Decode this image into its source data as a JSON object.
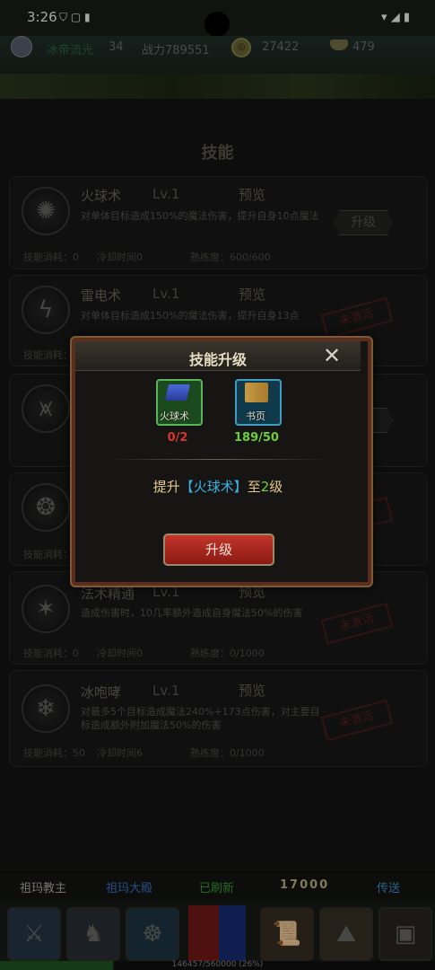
{
  "status_bar": {
    "time": "3:26"
  },
  "player": {
    "name": "冰帝流光",
    "level": "34",
    "power": "战力789551",
    "coins": "27422",
    "ingots": "479"
  },
  "panel": {
    "title": "技能"
  },
  "skills": [
    {
      "name": "火球术",
      "level": "Lv.1",
      "preview": "预览",
      "desc": "对单体目标造成150%的魔法伤害，提升自身10点魔法",
      "cost": "技能消耗：0",
      "cooldown": "冷却时间0",
      "mastery": "熟练度：600/600",
      "action": "升级"
    },
    {
      "name": "雷电术",
      "level": "Lv.1",
      "preview": "预览",
      "desc": "对单体目标造成150%的魔法伤害，提升自身13点",
      "cost": "技能消耗：",
      "stamp": "未激活"
    },
    {
      "name": "法术精通",
      "level": "Lv.1",
      "preview": "预览",
      "desc": "造成伤害时，10几率额外造成自身魔法50%的伤害",
      "cost": "技能消耗：0",
      "cooldown": "冷却时间0",
      "mastery": "熟练度：0/1000",
      "stamp": "未激活"
    },
    {
      "name": "冰咆哮",
      "level": "Lv.1",
      "preview": "预览",
      "desc": "对最多5个目标造成魔法240%+173点伤害，对主要目标造成额外附加魔法50%的伤害",
      "cost": "技能消耗：50",
      "cooldown": "冷却时间6",
      "mastery": "熟练度：0/1000",
      "stamp": "未激活"
    }
  ],
  "partial": {
    "cost": "技能消耗：",
    "learn": "习"
  },
  "modal": {
    "title": "技能升级",
    "item1_label": "火球术",
    "item1_count": "0/2",
    "item2_label": "书页",
    "item2_count": "189/50",
    "upgrade_prefix": "提升",
    "upgrade_skill": "【火球术】",
    "upgrade_mid": "至",
    "upgrade_level": "2级",
    "button": "升级"
  },
  "bottom_bar": {
    "npc": "祖玛教主",
    "location": "祖玛大殿",
    "refresh": "已刷新",
    "value": "17000",
    "teleport": "传送"
  },
  "exp": {
    "text": "146457/560000 (26%)",
    "fraction": 0.26
  }
}
